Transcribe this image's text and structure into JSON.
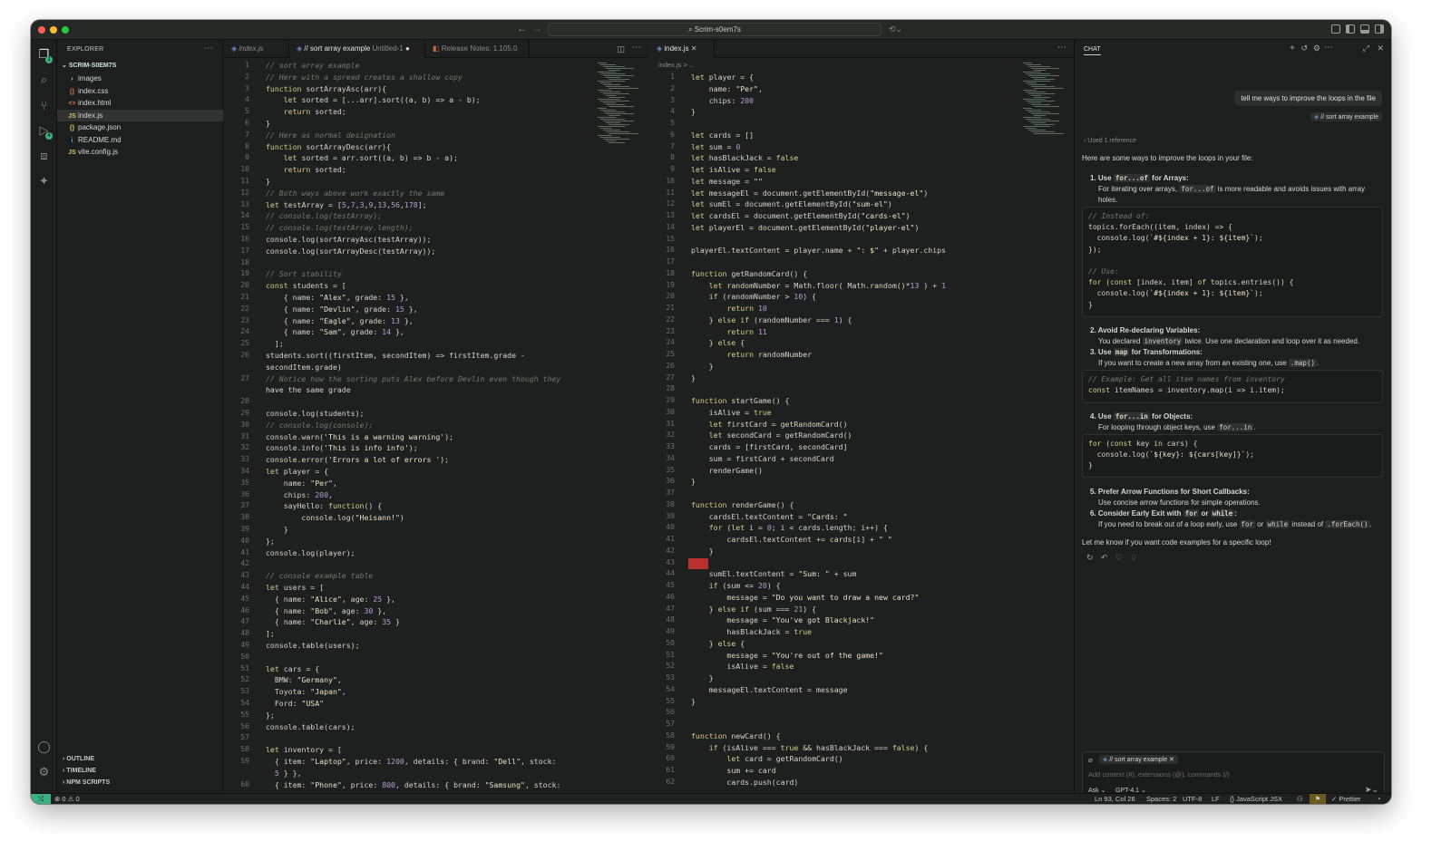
{
  "title": {
    "search": "Scrim-s0em7s"
  },
  "explorer": {
    "title": "EXPLORER",
    "root": "SCRIM-S0EM7S",
    "items": [
      {
        "label": "images",
        "icon": "folder-icon"
      },
      {
        "label": "index.css",
        "icon": "css-icon"
      },
      {
        "label": "index.html",
        "icon": "html-icon"
      },
      {
        "label": "index.js",
        "icon": "js-icon"
      },
      {
        "label": "package.json",
        "icon": "json-icon"
      },
      {
        "label": "README.md",
        "icon": "info-icon"
      },
      {
        "label": "vite.config.js",
        "icon": "js-icon"
      }
    ],
    "outline": "OUTLINE",
    "timeline": "TIMELINE",
    "npm": "NPM SCRIPTS"
  },
  "left_tabs": [
    {
      "label": "index.js"
    },
    {
      "label": "// sort array example",
      "sub": "Untitled-1"
    },
    {
      "label": "Release Notes: 1.105.0"
    }
  ],
  "right_tab": {
    "label": "index.js",
    "breadcrumb": "index.js > ..."
  },
  "left_code": [
    [
      "1",
      "// sort array example"
    ],
    [
      "2",
      "// Here with a spread creates a shallow copy"
    ],
    [
      "3",
      "function sortArrayAsc(arr){"
    ],
    [
      "4",
      "    let sorted = [...arr].sort((a, b) => a - b);"
    ],
    [
      "5",
      "    return sorted;"
    ],
    [
      "6",
      "}"
    ],
    [
      "7",
      "// Here as normal designation"
    ],
    [
      "8",
      "function sortArrayDesc(arr){"
    ],
    [
      "9",
      "    let sorted = arr.sort((a, b) => b - a);"
    ],
    [
      "10",
      "    return sorted;"
    ],
    [
      "11",
      "}"
    ],
    [
      "12",
      "// Both ways above work exactly the same"
    ],
    [
      "13",
      "let testArray = [5,7,3,9,13,56,178];"
    ],
    [
      "14",
      "// console.log(testArray);"
    ],
    [
      "15",
      "// console.log(testArray.length);"
    ],
    [
      "16",
      "console.log(sortArrayAsc(testArray));"
    ],
    [
      "17",
      "console.log(sortArrayDesc(testArray));"
    ],
    [
      "18",
      ""
    ],
    [
      "19",
      "// Sort stability"
    ],
    [
      "20",
      "const students = ["
    ],
    [
      "21",
      "    { name: \"Alex\", grade: 15 },"
    ],
    [
      "22",
      "    { name: \"Devlin\", grade: 15 },"
    ],
    [
      "23",
      "    { name: \"Eagle\", grade: 13 },"
    ],
    [
      "24",
      "    { name: \"Sam\", grade: 14 },"
    ],
    [
      "25",
      "  ];"
    ],
    [
      "26",
      "students.sort((firstItem, secondItem) => firstItem.grade -"
    ],
    [
      "",
      "secondItem.grade)"
    ],
    [
      "27",
      "// Notice how the sorting puts Alex before Devlin even though they"
    ],
    [
      "",
      "have the same grade"
    ],
    [
      "28",
      ""
    ],
    [
      "29",
      "console.log(students);"
    ],
    [
      "30",
      "// console.log(console);"
    ],
    [
      "31",
      "console.warn('This is a warning warning');"
    ],
    [
      "32",
      "console.info('This is info info');"
    ],
    [
      "33",
      "console.error('Errors a lot of errors ');"
    ],
    [
      "34",
      "let player = {"
    ],
    [
      "35",
      "    name: \"Per\","
    ],
    [
      "36",
      "    chips: 200,"
    ],
    [
      "37",
      "    sayHello: function() {"
    ],
    [
      "38",
      "        console.log(\"Heisann!\")"
    ],
    [
      "39",
      "    }"
    ],
    [
      "40",
      "};"
    ],
    [
      "41",
      "console.log(player);"
    ],
    [
      "42",
      ""
    ],
    [
      "43",
      "// console example table"
    ],
    [
      "44",
      "let users = ["
    ],
    [
      "45",
      "  { name: \"Alice\", age: 25 },"
    ],
    [
      "46",
      "  { name: \"Bob\", age: 30 },"
    ],
    [
      "47",
      "  { name: \"Charlie\", age: 35 }"
    ],
    [
      "48",
      "];"
    ],
    [
      "49",
      "console.table(users);"
    ],
    [
      "50",
      ""
    ],
    [
      "51",
      "let cars = {"
    ],
    [
      "52",
      "  BMW: \"Germany\","
    ],
    [
      "53",
      "  Toyota: \"Japan\","
    ],
    [
      "54",
      "  Ford: \"USA\""
    ],
    [
      "55",
      "};"
    ],
    [
      "56",
      "console.table(cars);"
    ],
    [
      "57",
      ""
    ],
    [
      "58",
      "let inventory = ["
    ],
    [
      "59",
      "  { item: \"Laptop\", price: 1200, details: { brand: \"Dell\", stock:"
    ],
    [
      "",
      "  5 } },"
    ],
    [
      "60",
      "  { item: \"Phone\", price: 800, details: { brand: \"Samsung\", stock:"
    ]
  ],
  "right_code": [
    [
      "1",
      "let player = {"
    ],
    [
      "2",
      "    name: \"Per\","
    ],
    [
      "3",
      "    chips: 200"
    ],
    [
      "4",
      "}"
    ],
    [
      "5",
      ""
    ],
    [
      "6",
      "let cards = []"
    ],
    [
      "7",
      "let sum = 0"
    ],
    [
      "8",
      "let hasBlackJack = false"
    ],
    [
      "9",
      "let isAlive = false"
    ],
    [
      "10",
      "let message = \"\""
    ],
    [
      "11",
      "let messageEl = document.getElementById(\"message-el\")"
    ],
    [
      "12",
      "let sumEl = document.getElementById(\"sum-el\")"
    ],
    [
      "13",
      "let cardsEl = document.getElementById(\"cards-el\")"
    ],
    [
      "14",
      "let playerEl = document.getElementById(\"player-el\")"
    ],
    [
      "15",
      ""
    ],
    [
      "16",
      "playerEl.textContent = player.name + \": $\" + player.chips"
    ],
    [
      "17",
      ""
    ],
    [
      "18",
      "function getRandomCard() {"
    ],
    [
      "19",
      "    let randomNumber = Math.floor( Math.random()*13 ) + 1"
    ],
    [
      "20",
      "    if (randomNumber > 10) {"
    ],
    [
      "21",
      "        return 10"
    ],
    [
      "22",
      "    } else if (randomNumber === 1) {"
    ],
    [
      "23",
      "        return 11"
    ],
    [
      "24",
      "    } else {"
    ],
    [
      "25",
      "        return randomNumber"
    ],
    [
      "26",
      "    }"
    ],
    [
      "27",
      "}"
    ],
    [
      "28",
      ""
    ],
    [
      "29",
      "function startGame() {"
    ],
    [
      "30",
      "    isAlive = true"
    ],
    [
      "31",
      "    let firstCard = getRandomCard()"
    ],
    [
      "32",
      "    let secondCard = getRandomCard()"
    ],
    [
      "33",
      "    cards = [firstCard, secondCard]"
    ],
    [
      "34",
      "    sum = firstCard + secondCard"
    ],
    [
      "35",
      "    renderGame()"
    ],
    [
      "36",
      "}"
    ],
    [
      "37",
      ""
    ],
    [
      "38",
      "function renderGame() {"
    ],
    [
      "39",
      "    cardsEl.textContent = \"Cards: \""
    ],
    [
      "40",
      "    for (let i = 0; i < cards.length; i++) {"
    ],
    [
      "41",
      "        cardsEl.textContent += cards[i] + \" \""
    ],
    [
      "42",
      "    }"
    ],
    [
      "43",
      ""
    ],
    [
      "44",
      "    sumEl.textContent = \"Sum: \" + sum"
    ],
    [
      "45",
      "    if (sum <= 20) {"
    ],
    [
      "46",
      "        message = \"Do you want to draw a new card?\""
    ],
    [
      "47",
      "    } else if (sum === 21) {"
    ],
    [
      "48",
      "        message = \"You've got Blackjack!\""
    ],
    [
      "49",
      "        hasBlackJack = true"
    ],
    [
      "50",
      "    } else {"
    ],
    [
      "51",
      "        message = \"You're out of the game!\""
    ],
    [
      "52",
      "        isAlive = false"
    ],
    [
      "53",
      "    }"
    ],
    [
      "54",
      "    messageEl.textContent = message"
    ],
    [
      "55",
      "}"
    ],
    [
      "56",
      ""
    ],
    [
      "57",
      ""
    ],
    [
      "58",
      "function newCard() {"
    ],
    [
      "59",
      "    if (isAlive === true && hasBlackJack === false) {"
    ],
    [
      "60",
      "        let card = getRandomCard()"
    ],
    [
      "61",
      "        sum += card"
    ],
    [
      "62",
      "        cards.push(card)"
    ]
  ],
  "chat": {
    "title": "CHAT",
    "user_message": "tell me ways to improve the loops in the file",
    "user_ref": "// sort array example",
    "references": "Used 1 reference",
    "intro": "Here are some ways to improve the loops in your file:",
    "p1_title_a": "Use ",
    "p1_code": "for...of",
    "p1_title_b": " for Arrays:",
    "p1_desc_a": "For iterating over arrays, ",
    "p1_desc_code": "for...of",
    "p1_desc_b": " is more readable and avoids issues with array",
    "p1_desc_c": "holes.",
    "block1": [
      "// Instead of:",
      "topics.forEach((item, index) => {",
      "  console.log(`#${index + 1}: ${item}`);",
      "});",
      "",
      "// Use:",
      "for (const [index, item] of topics.entries()) {",
      "  console.log(`#${index + 1}: ${item}`);",
      "}"
    ],
    "p2_title": "Avoid Re-declaring Variables:",
    "p2_desc_a": "You declared ",
    "p2_desc_code": "inventory",
    "p2_desc_b": " twice. Use one declaration and loop over it as needed.",
    "p3_title_a": "Use ",
    "p3_code": "map",
    "p3_title_b": " for Transformations:",
    "p3_desc_a": "If you want to create a new array from an existing one, use ",
    "p3_desc_code": ".map()",
    "p3_desc_b": ".",
    "block2": [
      "// Example: Get all item names from inventory",
      "const itemNames = inventory.map(i => i.item);"
    ],
    "p4_title_a": "Use ",
    "p4_code": "for...in",
    "p4_title_b": " for Objects:",
    "p4_desc_a": "For looping through object keys, use ",
    "p4_desc_code": "for...in",
    "p4_desc_b": ".",
    "block3": [
      "for (const key in cars) {",
      "  console.log(`${key}: ${cars[key]}`);",
      "}"
    ],
    "p5_title": "Prefer Arrow Functions for Short Callbacks:",
    "p5_desc": "Use concise arrow functions for simple operations.",
    "p6_title_a": "Consider Early Exit with ",
    "p6_code1": "for",
    "p6_title_b": " or ",
    "p6_code2": "while",
    "p6_title_c": ":",
    "p6_desc_a": "If you need to break out of a loop early, use ",
    "p6_desc_code1": "for",
    "p6_desc_b": " or ",
    "p6_desc_code2": "while",
    "p6_desc_c": " instead of ",
    "p6_desc_code3": ".forEach()",
    "p6_desc_d": ".",
    "outro": "Let me know if you want code examples for a specific loop!",
    "input_ref": "// sort array example",
    "input_placeholder": "Add context (#), extensions (@), commands (/)",
    "mode": "Ask",
    "model": "GPT-4.1"
  },
  "status": {
    "errors": "0",
    "warnings": "0",
    "position": "Ln 93, Col 26",
    "spaces": "Spaces: 2",
    "encoding": "UTF-8",
    "eol": "LF",
    "language": "JavaScript JSX",
    "prettier": "Prettier"
  },
  "colors": {
    "accent": "#3fb07f",
    "error": "#b8302d"
  }
}
